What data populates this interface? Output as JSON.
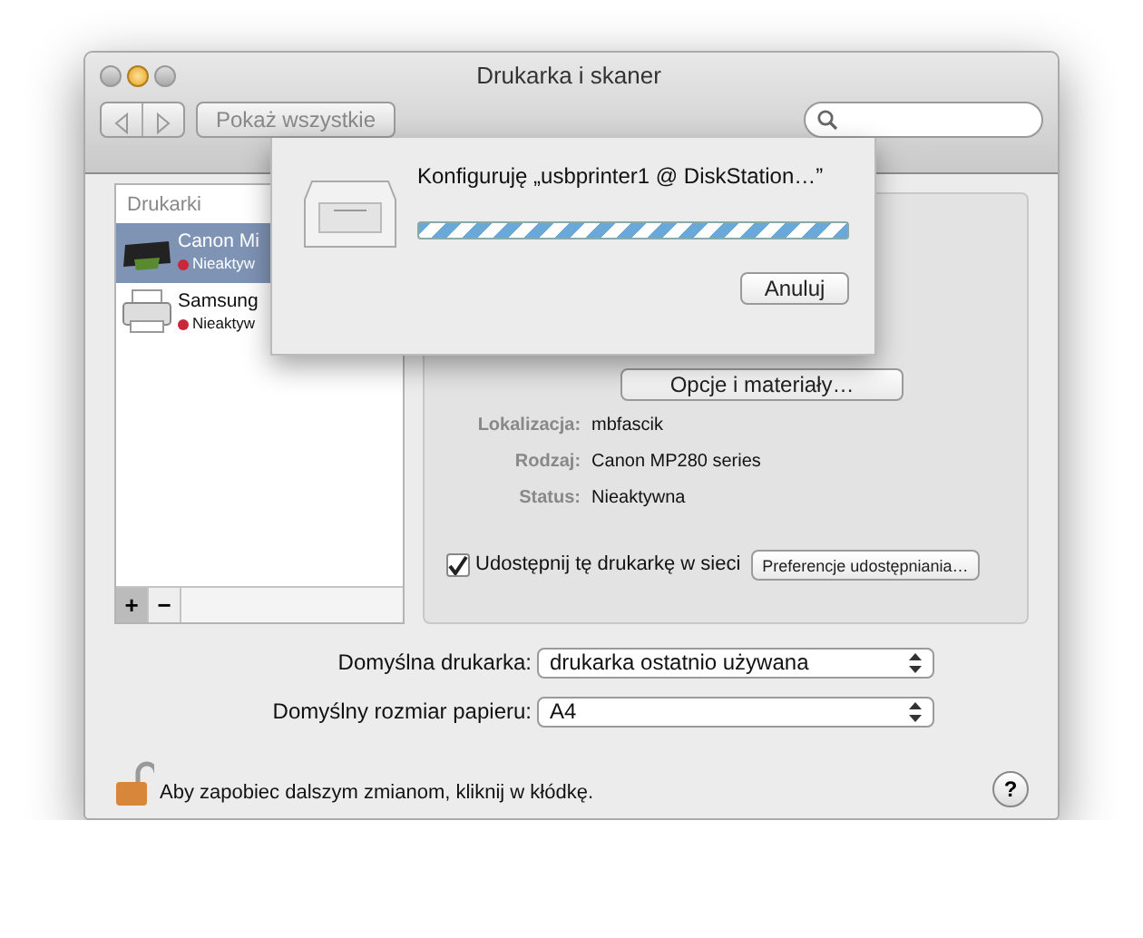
{
  "window": {
    "title": "Drukarka i skaner"
  },
  "toolbar": {
    "show_all": "Pokaż wszystkie"
  },
  "printers": {
    "heading": "Drukarki",
    "items": [
      {
        "name": "Canon Mi",
        "status": "Nieaktyw",
        "selected": true,
        "kind": "inkjet"
      },
      {
        "name": "Samsung",
        "status": "Nieaktyw",
        "selected": false,
        "kind": "laser"
      }
    ]
  },
  "list_buttons": [
    "+",
    "−"
  ],
  "details": {
    "options_button": "Opcje i materiały…",
    "fields": [
      {
        "label": "Lokalizacja:",
        "value": "mbfascik"
      },
      {
        "label": "Rodzaj:",
        "value": "Canon MP280 series"
      },
      {
        "label": "Status:",
        "value": "Nieaktywna"
      }
    ],
    "share": {
      "label": "Udostępnij tę drukarkę w sieci",
      "checked": true
    },
    "sharing_prefs": "Preferencje udostępniania…"
  },
  "defaults": [
    {
      "label": "Domyślna drukarka:",
      "value": "drukarka ostatnio używana"
    },
    {
      "label": "Domyślny rozmiar papieru:",
      "value": "A4"
    }
  ],
  "lock": {
    "text": "Aby zapobiec dalszym zmianom, kliknij w kłódkę.",
    "locked": false
  },
  "help": "?",
  "sheet": {
    "title": "Konfiguruję „usbprinter1 @ DiskStation…”",
    "indeterminate": true,
    "cancel": "Anuluj"
  }
}
